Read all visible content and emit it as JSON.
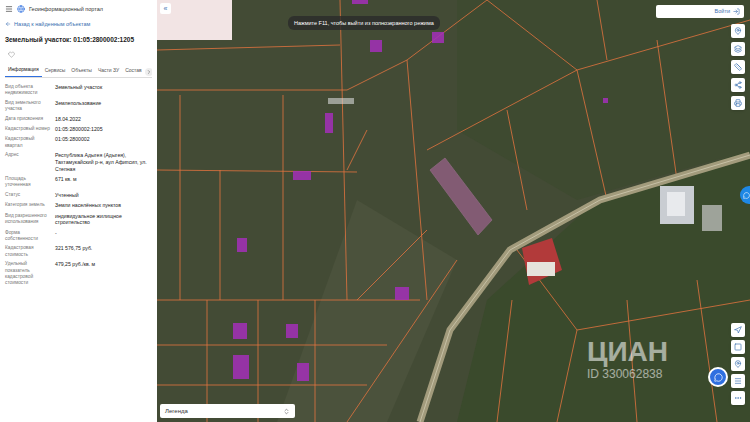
{
  "header": {
    "title": "Геоинформационный портал"
  },
  "back_link": "Назад к найденным объектам",
  "object_title": "Земельный участок: 01:05:2800002:1205",
  "favorite": false,
  "tabs": [
    {
      "label": "Информация",
      "selected": true
    },
    {
      "label": "Сервисы",
      "selected": false
    },
    {
      "label": "Объекты",
      "selected": false
    },
    {
      "label": "Части ЗУ",
      "selected": false
    },
    {
      "label": "Состав",
      "selected": false
    }
  ],
  "properties": [
    {
      "label": "Вид объекта недвижимости",
      "value": "Земельный участок"
    },
    {
      "label": "Вид земельного участка",
      "value": "Землепользование"
    },
    {
      "label": "Дата присвоения",
      "value": "18.04.2022"
    },
    {
      "label": "Кадастровый номер",
      "value": "01:05:2800002:1205"
    },
    {
      "label": "Кадастровый квартал",
      "value": "01:05:2800002"
    },
    {
      "label": "Адрес",
      "value": "Республика Адыгея (Адыгея), Тахтамукайский р-н, аул Афипсип, ул. Степная"
    },
    {
      "label": "Площадь уточненная",
      "value": "671 кв. м"
    },
    {
      "label": "Статус",
      "value": "Учтенный"
    },
    {
      "label": "Категория земель",
      "value": "Земли населённых пунктов"
    },
    {
      "label": "Вид разрешенного использования",
      "value": "индивидуальное жилищное строительство"
    },
    {
      "label": "Форма собственности",
      "value": "-"
    },
    {
      "label": "Кадастровая стоимость",
      "value": "321 576,75 руб."
    },
    {
      "label": "Удельный показатель кадастровой стоимости",
      "value": "479,25 руб./кв. м"
    }
  ],
  "map": {
    "collapse": "«",
    "fullscreen_hint": "Нажмите F11, чтобы выйти из полноэкранного режима",
    "login_button": "Войти",
    "legend": "Легенда"
  },
  "watermark": {
    "brand": "ЦИАН",
    "id": "ID 330062838"
  }
}
